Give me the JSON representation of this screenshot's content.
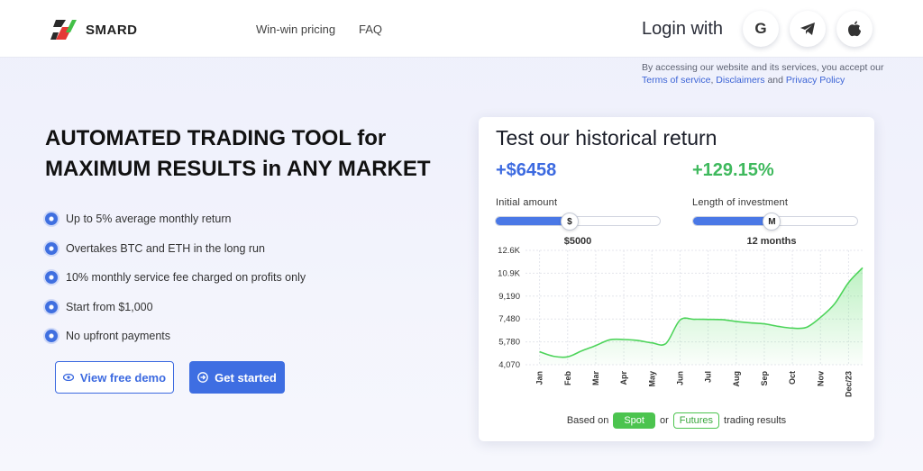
{
  "header": {
    "brand": "SMARD",
    "nav": [
      "Win-win pricing",
      "FAQ"
    ],
    "login_label": "Login with",
    "social": [
      "G",
      "telegram",
      "apple"
    ]
  },
  "terms": {
    "prefix": "By accessing our website and its services, you accept our",
    "terms_link": "Terms of service",
    "sep": ",",
    "disclaimers_link": "Disclaimers",
    "and": "and",
    "privacy_link": "Privacy Policy"
  },
  "hero": {
    "headline_line1": "AUTOMATED TRADING TOOL for",
    "headline_line2": "MAXIMUM RESULTS in ANY MARKET",
    "features": [
      "Up to 5% average monthly return",
      "Overtakes BTC and ETH in the long run",
      "10% monthly service fee charged on profits only",
      "Start from $1,000",
      "No upfront payments"
    ],
    "demo_button": "View free demo",
    "start_button": "Get started"
  },
  "card": {
    "title": "Test our historical return",
    "return_amount": "+$6458",
    "return_percent": "+129.15%",
    "amount_label": "Initial amount",
    "amount_thumb": "$",
    "amount_value": "$5000",
    "amount_fill": 0.45,
    "length_label": "Length of investment",
    "length_thumb": "M",
    "length_value": "12 months",
    "length_fill": 0.48,
    "based_on": "Based on",
    "spot": "Spot",
    "or": "or",
    "futures": "Futures",
    "trading_results": "trading results"
  },
  "colors": {
    "accent_blue": "#3c6ae0",
    "accent_green": "#3fb95d"
  },
  "chart_data": {
    "type": "area",
    "title": "",
    "xlabel": "",
    "ylabel": "",
    "categories": [
      "Jan",
      "Feb",
      "Mar",
      "Apr",
      "May",
      "Jun",
      "Jul",
      "Aug",
      "Sep",
      "Oct",
      "Nov",
      "Dec/23"
    ],
    "y_ticks": [
      "4,070",
      "5,780",
      "7,480",
      "9,190",
      "10.9K",
      "12.6K"
    ],
    "ylim": [
      4070,
      12600
    ],
    "x": [
      0,
      0.5,
      1,
      1.5,
      2,
      2.5,
      3,
      3.5,
      4,
      4.5,
      5,
      5.5,
      6,
      6.5,
      7,
      7.5,
      8,
      8.5,
      9,
      9.5,
      10,
      10.5,
      11,
      11.5
    ],
    "values": [
      5040,
      4700,
      4660,
      5100,
      5500,
      5930,
      5950,
      5880,
      5700,
      5660,
      7400,
      7460,
      7450,
      7430,
      7300,
      7200,
      7120,
      6930,
      6800,
      6860,
      7600,
      8600,
      10200,
      11300
    ],
    "grid": true
  }
}
